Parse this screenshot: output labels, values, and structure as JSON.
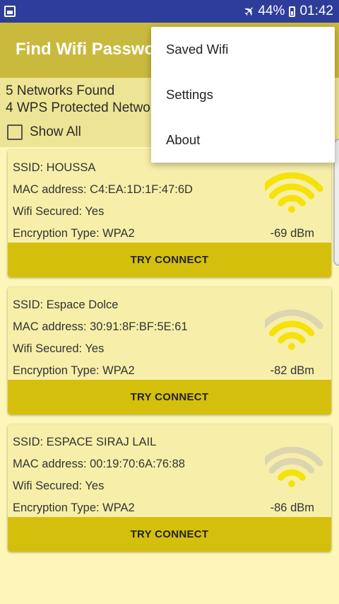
{
  "status_bar": {
    "battery": "44%",
    "time": "01:42",
    "icons": [
      "gallery-icon",
      "airplane-mode-icon",
      "battery-icon"
    ]
  },
  "app_bar": {
    "title": "Find Wifi Password"
  },
  "summary": {
    "networks_found": "5  Networks Found",
    "wps_protected": "4  WPS Protected Networks",
    "show_all_label": "Show All",
    "show_all_checked": false
  },
  "networks": [
    {
      "ssid": "SSID: HOUSSA",
      "mac": "MAC address: C4:EA:1D:1F:47:6D",
      "secured": "Wifi Secured: Yes",
      "encryption": "Encryption Type: WPA2",
      "signal": "-69 dBm",
      "bars_filled": 3,
      "button": "TRY CONNECT"
    },
    {
      "ssid": "SSID: Espace Dolce",
      "mac": "MAC address: 30:91:8F:BF:5E:61",
      "secured": "Wifi Secured: Yes",
      "encryption": "Encryption Type: WPA2",
      "signal": "-82 dBm",
      "bars_filled": 2,
      "button": "TRY CONNECT"
    },
    {
      "ssid": "SSID: ESPACE SIRAJ LAIL",
      "mac": "MAC address: 00:19:70:6A:76:88",
      "secured": "Wifi Secured: Yes",
      "encryption": "Encryption Type: WPA2",
      "signal": "-86 dBm",
      "bars_filled": 1,
      "button": "TRY CONNECT"
    }
  ],
  "menu": {
    "items": [
      "Saved Wifi",
      "Settings",
      "About"
    ]
  },
  "colors": {
    "status_bar": "#2f3d9a",
    "app_bar": "#c9ba3e",
    "background": "#fdf6b8",
    "card": "#f7efa9",
    "button": "#d4c00c",
    "wifi_on": "#f5e20c",
    "wifi_off": "#dcd5b0"
  }
}
